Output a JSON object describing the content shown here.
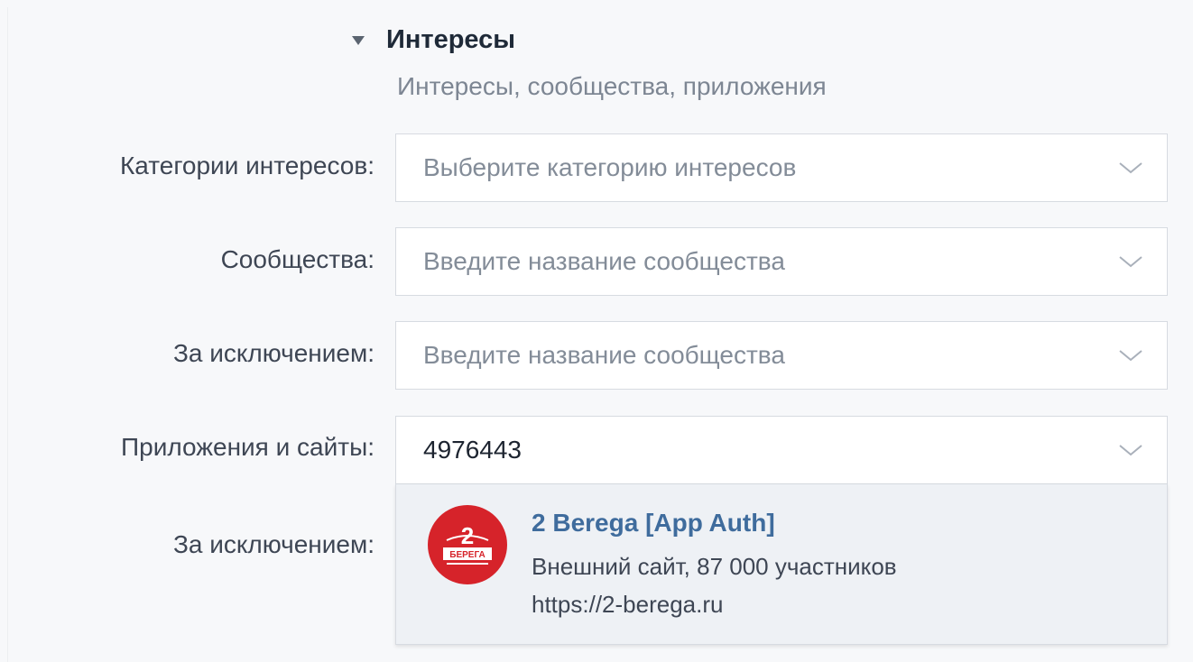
{
  "section": {
    "title": "Интересы",
    "subtitle": "Интересы, сообщества, приложения"
  },
  "rows": [
    {
      "label": "Категории интересов:",
      "placeholder": "Выберите категорию интересов",
      "value": ""
    },
    {
      "label": "Сообщества:",
      "placeholder": "Введите название сообщества",
      "value": ""
    },
    {
      "label": "За исключением:",
      "placeholder": "Введите название сообщества",
      "value": ""
    },
    {
      "label": "Приложения и сайты:",
      "placeholder": "",
      "value": "4976443"
    },
    {
      "label": "За исключением:",
      "placeholder": "",
      "value": ""
    }
  ],
  "suggestion": {
    "title": "2 Berega [App Auth]",
    "description": "Внешний сайт, 87 000 участников",
    "url": "https://2-berega.ru",
    "logo_text": "2",
    "logo_caption": "БЕРЕГА"
  },
  "colors": {
    "logo_red": "#d6232a",
    "link_blue": "#3f6c9d",
    "border": "#d7dbe1",
    "background": "#f7f8fa"
  }
}
